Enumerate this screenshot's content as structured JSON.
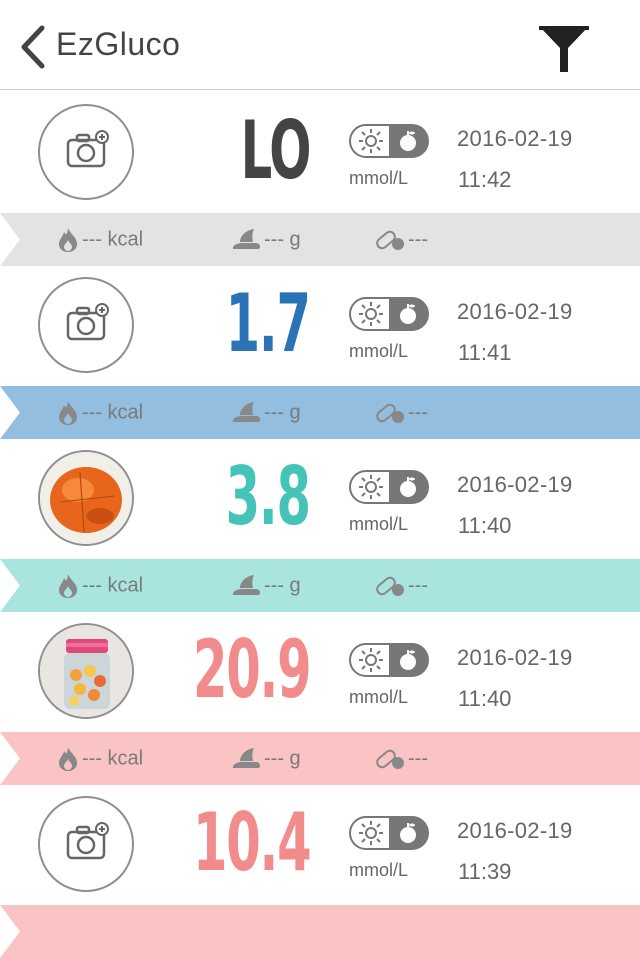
{
  "header": {
    "title": "EzGluco",
    "back_icon": "chevron-left-icon",
    "filter_icon": "filter-icon"
  },
  "colors": {
    "lo": "#444444",
    "low": "#2a73b4",
    "normal": "#44c4b6",
    "high": "#f28b8b",
    "band_gray": "#e3e3e3",
    "band_blue": "#94bedf",
    "band_teal": "#a9e4df",
    "band_pink": "#fbc4c4"
  },
  "entries": [
    {
      "value": "LO",
      "unit": "mmol/L",
      "date": "2016-02-19",
      "time": "11:42",
      "kcal": "--- kcal",
      "carbs": "--- g",
      "meds": "---",
      "thumb": "camera-add-icon"
    },
    {
      "value": "1.7",
      "unit": "mmol/L",
      "date": "2016-02-19",
      "time": "11:41",
      "kcal": "--- kcal",
      "carbs": "--- g",
      "meds": "---",
      "thumb": "camera-add-icon"
    },
    {
      "value": "3.8",
      "unit": "mmol/L",
      "date": "2016-02-19",
      "time": "11:40",
      "kcal": "--- kcal",
      "carbs": "--- g",
      "meds": "---",
      "thumb": "orange-photo"
    },
    {
      "value": "20.9",
      "unit": "mmol/L",
      "date": "2016-02-19",
      "time": "11:40",
      "kcal": "--- kcal",
      "carbs": "--- g",
      "meds": "---",
      "thumb": "candy-jar-photo"
    },
    {
      "value": "10.4",
      "unit": "mmol/L",
      "date": "2016-02-19",
      "time": "11:39",
      "kcal": "",
      "carbs": "",
      "meds": "",
      "thumb": "camera-add-icon"
    }
  ]
}
